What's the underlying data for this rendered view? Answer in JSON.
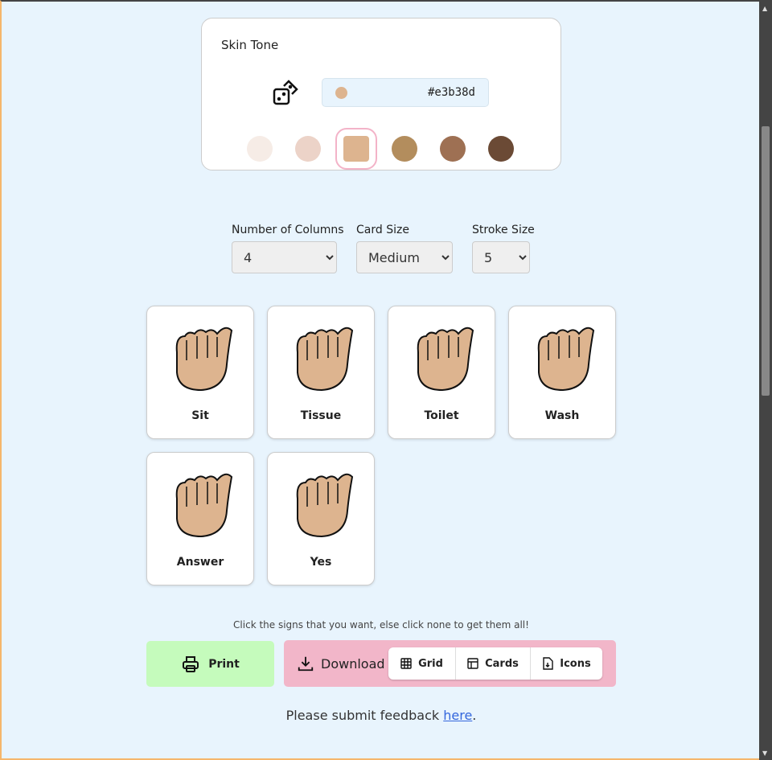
{
  "skin_tone": {
    "title": "Skin Tone",
    "hex": "#e3b38d",
    "selected_color": "#ddb48f",
    "swatches": [
      "#f6ece6",
      "#ecd3c8",
      "#ddb48f",
      "#b38d5d",
      "#9e7053",
      "#6b4a35"
    ],
    "selected_index": 2
  },
  "controls": [
    {
      "label": "Number of Columns",
      "value": "4"
    },
    {
      "label": "Card Size",
      "value": "Medium"
    },
    {
      "label": "Stroke Size",
      "value": "5"
    }
  ],
  "cards": [
    "Sit",
    "Tissue",
    "Toilet",
    "Wash",
    "Answer",
    "Yes"
  ],
  "hint": "Click the signs that you want, else click none to get them all!",
  "print_label": "Print",
  "download": {
    "label": "Download",
    "options": [
      "Grid",
      "Cards",
      "Icons"
    ]
  },
  "feedback": {
    "text": "Please submit feedback ",
    "link": "here",
    "end": "."
  }
}
